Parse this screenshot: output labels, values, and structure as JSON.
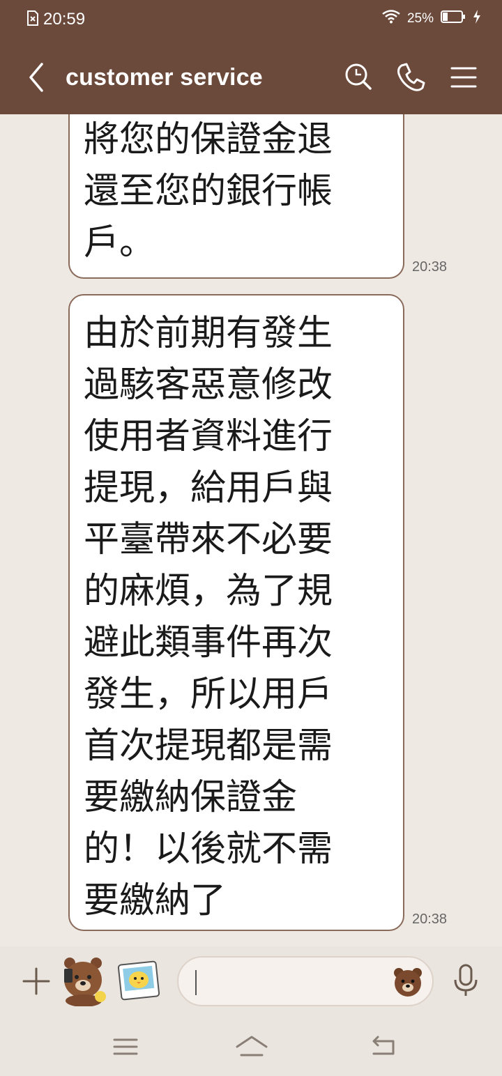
{
  "status_bar": {
    "time": "20:59",
    "battery_percent": "25%",
    "icons": [
      "no-sim-icon",
      "wifi-icon",
      "battery-icon",
      "charging-icon"
    ]
  },
  "header": {
    "title": "customer service",
    "icons": [
      "back-arrow-icon",
      "search-icon",
      "phone-icon",
      "menu-icon"
    ]
  },
  "messages": [
    {
      "text": "將您的保證金退\n還至您的銀行帳\n戶。",
      "time": "20:38"
    },
    {
      "text": "由於前期有發生\n過駭客惡意修改\n使用者資料進行\n提現，給用戶與\n平臺帶來不必要\n的麻煩，為了規\n避此類事件再次\n發生，所以用戶\n首次提現都是需\n要繳納保證金\n的！以後就不需\n要繳納了",
      "time": "20:38"
    }
  ],
  "input_bar": {
    "value": "",
    "icons": [
      "plus-icon",
      "bear-sticker-icon",
      "chick-sticker-icon",
      "emoji-icon",
      "microphone-icon"
    ]
  },
  "nav_bar": {
    "icons": [
      "menu-icon",
      "home-icon",
      "back-icon"
    ]
  },
  "colors": {
    "header_bg": "#6b4a3c",
    "chat_bg": "#efe9e3",
    "bubble_bg": "#ffffff",
    "bubble_border": "#8a6a5a"
  }
}
